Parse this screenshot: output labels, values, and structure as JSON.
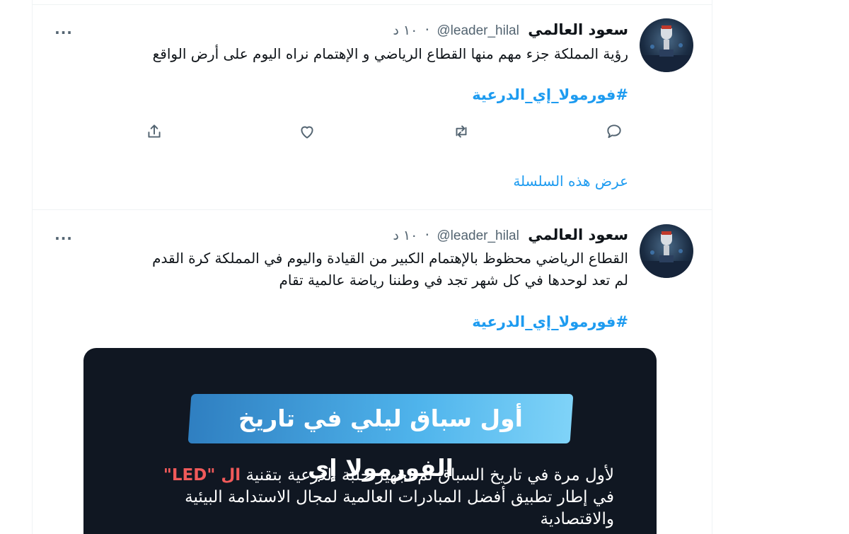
{
  "tweets": [
    {
      "display_name": "سعود العالمي",
      "handle": "@leader_hilal",
      "separator": "·",
      "time": "١٠ د",
      "more_label": "...",
      "text": "رؤية المملكة جزء مهم منها القطاع الرياضي و الإهتمام نراه اليوم على أرض الواقع",
      "hashtag": "#فورمولا_إي_الدرعية",
      "thread_link": "عرض هذه السلسلة"
    },
    {
      "display_name": "سعود العالمي",
      "handle": "@leader_hilal",
      "separator": "·",
      "time": "١٠ د",
      "more_label": "...",
      "text_line1": "القطاع الرياضي محظوظ بالإهتمام الكبير من القيادة واليوم في المملكة كرة القدم",
      "text_line2": "لم تعد لوحدها في كل شهر تجد في وطننا رياضة عالمية تقام",
      "hashtag": "#فورمولا_إي_الدرعية",
      "media": {
        "banner_text": "أول سباق ليلي في تاريخ الفورمولا إي",
        "caption_part1": "لأول مرة في تاريخ السباق تم تجهيز حلبة الدرعية بتقنية",
        "caption_highlight": "ال \"LED\"",
        "caption_line2": "في إطار تطبيق أفضل المبادرات العالمية لمجال الاستدامة البيئية",
        "caption_line3": "والاقتصادية"
      }
    }
  ],
  "icons": {
    "reply": "reply-icon",
    "retweet": "retweet-icon",
    "like": "like-icon",
    "share": "share-icon",
    "more": "more-icon"
  },
  "colors": {
    "link": "#1d9bf0",
    "secondary_text": "#536471",
    "highlight": "#f05a5a",
    "media_background": "#101722"
  }
}
